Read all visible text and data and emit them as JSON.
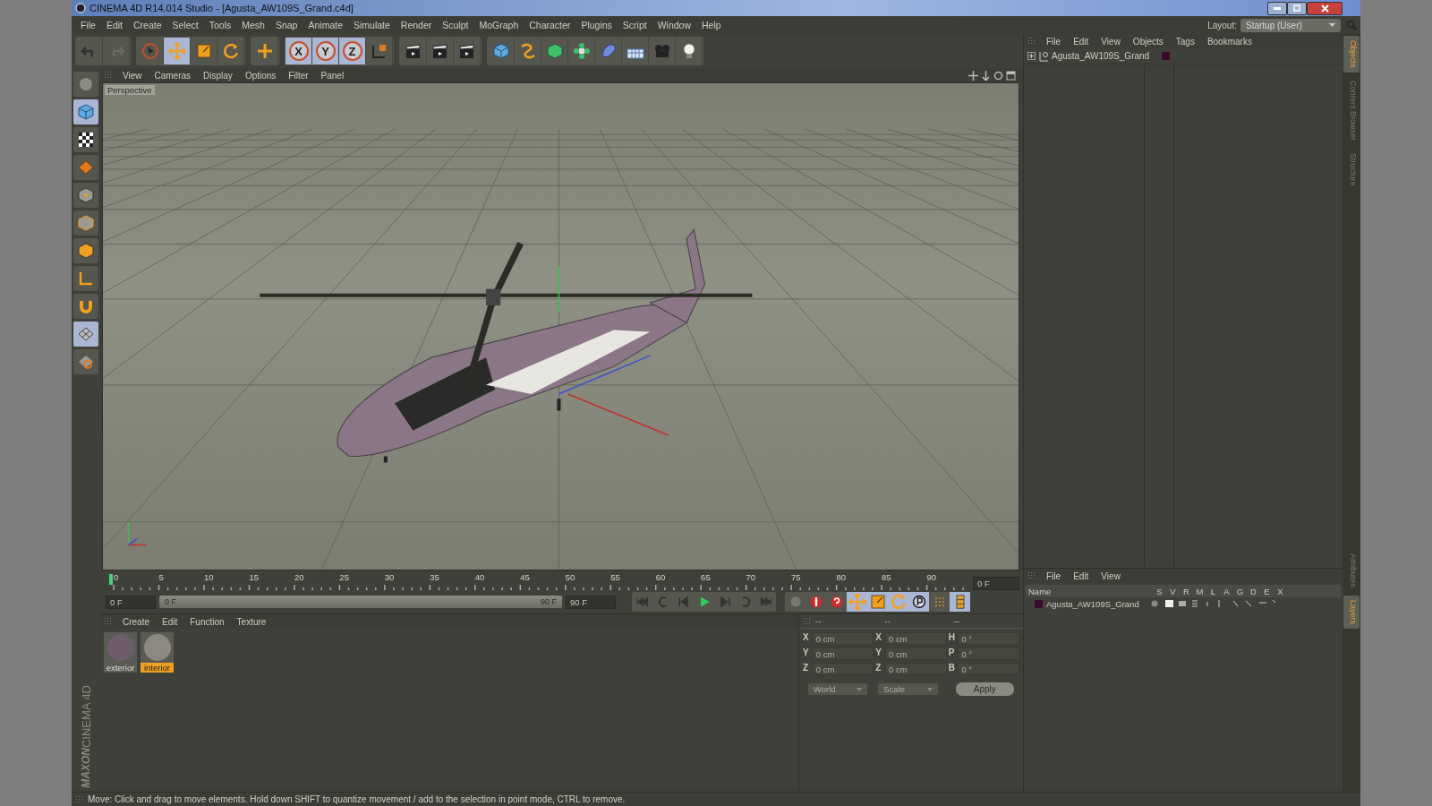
{
  "window": {
    "title": "CINEMA 4D R14.014 Studio - [Agusta_AW109S_Grand.c4d]"
  },
  "menu_bar": [
    "File",
    "Edit",
    "Create",
    "Select",
    "Tools",
    "Mesh",
    "Snap",
    "Animate",
    "Simulate",
    "Render",
    "Sculpt",
    "MoGraph",
    "Character",
    "Plugins",
    "Script",
    "Window",
    "Help"
  ],
  "layout": {
    "label": "Layout:",
    "value": "Startup (User)"
  },
  "toolbar": [
    [
      {
        "kind": "undo",
        "selected": false
      },
      {
        "kind": "redo",
        "selected": false
      }
    ],
    [
      {
        "kind": "select",
        "selected": false
      },
      {
        "kind": "move",
        "selected": true
      },
      {
        "kind": "scale",
        "selected": false
      },
      {
        "kind": "rotate",
        "selected": false
      }
    ],
    [
      {
        "kind": "add",
        "selected": false
      }
    ],
    [
      {
        "kind": "axis",
        "label": "X",
        "selected": true
      },
      {
        "kind": "axis",
        "label": "Y",
        "selected": true
      },
      {
        "kind": "axis",
        "label": "Z",
        "selected": true
      },
      {
        "kind": "coord",
        "selected": false
      }
    ],
    [
      {
        "kind": "render",
        "selected": false
      },
      {
        "kind": "render",
        "selected": false
      },
      {
        "kind": "render",
        "selected": false
      }
    ],
    [
      {
        "kind": "cube",
        "selected": false
      },
      {
        "kind": "spline",
        "selected": false
      },
      {
        "kind": "nurbs",
        "selected": false
      },
      {
        "kind": "cloner",
        "selected": false
      },
      {
        "kind": "deformer",
        "selected": false
      },
      {
        "kind": "floor",
        "selected": false
      },
      {
        "kind": "camera",
        "selected": false
      },
      {
        "kind": "light",
        "selected": false
      }
    ]
  ],
  "left_tools": [
    {
      "kind": "model",
      "selected": false
    },
    {
      "kind": "cube",
      "selected": true
    },
    {
      "kind": "checker",
      "selected": false
    },
    {
      "kind": "texture",
      "selected": false
    },
    {
      "kind": "points",
      "selected": false
    },
    {
      "kind": "edges",
      "selected": false
    },
    {
      "kind": "polygons",
      "selected": false
    },
    {
      "kind": "axis",
      "selected": false
    },
    {
      "kind": "magnet",
      "selected": false
    },
    {
      "kind": "workplane",
      "selected": true
    },
    {
      "kind": "snap",
      "selected": false
    }
  ],
  "viewport": {
    "menu": [
      "View",
      "Cameras",
      "Display",
      "Options",
      "Filter",
      "Panel"
    ],
    "label": "Perspective"
  },
  "timeline": {
    "ticks": [
      "0",
      "5",
      "10",
      "15",
      "20",
      "25",
      "30",
      "35",
      "40",
      "45",
      "50",
      "55",
      "60",
      "65",
      "70",
      "75",
      "80",
      "85",
      "90"
    ],
    "playhead": {
      "level": 0
    },
    "current_frame": "0 F",
    "start_field": "0 F",
    "range_start": "0 F",
    "range_end": "90 F",
    "range": {
      "level": 1
    },
    "end_field": "90 F",
    "transport": [
      {
        "kind": "first"
      },
      {
        "kind": "loop_back"
      },
      {
        "kind": "step_back"
      },
      {
        "kind": "play"
      },
      {
        "kind": "step_forward"
      },
      {
        "kind": "loop"
      },
      {
        "kind": "last"
      }
    ],
    "key_tools": [
      {
        "kind": "record_off",
        "selected": false
      },
      {
        "kind": "record",
        "selected": false
      },
      {
        "kind": "auto",
        "selected": false
      },
      {
        "kind": "move",
        "selected": true
      },
      {
        "kind": "scale",
        "selected": true
      },
      {
        "kind": "rotate",
        "selected": true
      },
      {
        "kind": "param",
        "selected": true
      },
      {
        "kind": "grid",
        "selected": false
      },
      {
        "kind": "film",
        "selected": true
      }
    ]
  },
  "materials": {
    "menu": [
      "Create",
      "Edit",
      "Function",
      "Texture"
    ],
    "items": [
      {
        "name": "exterior",
        "selected": false,
        "color": "#6e5c6c"
      },
      {
        "name": "interior",
        "selected": true,
        "color": "#8c8a80"
      }
    ]
  },
  "coordinates": {
    "headers": [
      "--",
      "--",
      "--"
    ],
    "rows": [
      [
        {
          "axis": "X",
          "value": "0 cm"
        },
        {
          "axis": "X",
          "value": "0 cm"
        },
        {
          "axis": "H",
          "value": "0 °"
        }
      ],
      [
        {
          "axis": "Y",
          "value": "0 cm"
        },
        {
          "axis": "Y",
          "value": "0 cm"
        },
        {
          "axis": "P",
          "value": "0 °"
        }
      ],
      [
        {
          "axis": "Z",
          "value": "0 cm"
        },
        {
          "axis": "Z",
          "value": "0 cm"
        },
        {
          "axis": "B",
          "value": "0 °"
        }
      ]
    ],
    "mode_select": "World",
    "scale_select": "Scale",
    "apply": "Apply"
  },
  "object_manager": {
    "menu": [
      "File",
      "Edit",
      "View",
      "Objects",
      "Tags",
      "Bookmarks"
    ],
    "objects": [
      {
        "name": "Agusta_AW109S_Grand",
        "color": "#3b0a30",
        "expanded": false
      }
    ]
  },
  "layer_manager": {
    "menu": [
      "File",
      "Edit",
      "View"
    ],
    "columns": [
      "Name",
      "S",
      "V",
      "R",
      "M",
      "L",
      "A",
      "G",
      "D",
      "E",
      "X"
    ],
    "rows": [
      {
        "name": "Agusta_AW109S_Grand",
        "color": "#3b0a30"
      }
    ]
  },
  "side_tabs_top": [
    {
      "label": "Objects",
      "selected": true
    },
    {
      "label": "Content Browser",
      "selected": false
    },
    {
      "label": "Structure",
      "selected": false
    }
  ],
  "side_tabs_bottom": [
    {
      "label": "Attributes",
      "selected": false
    },
    {
      "label": "Layers",
      "selected": true
    }
  ],
  "brand": {
    "company": "MAXON",
    "product": "CINEMA 4D"
  },
  "status_bar": "Move: Click and drag to move elements. Hold down SHIFT to quantize movement / add to the selection in point mode, CTRL to remove."
}
